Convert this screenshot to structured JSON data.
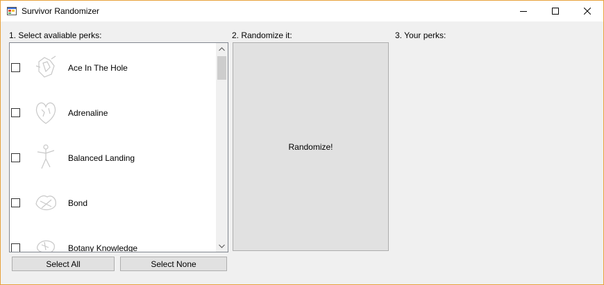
{
  "window": {
    "title": "Survivor Randomizer",
    "icon": "windows-forms-app-icon"
  },
  "controls": {
    "minimize_icon": "minimize-icon",
    "maximize_icon": "maximize-icon",
    "close_icon": "close-icon"
  },
  "section1": {
    "label": "1. Select avaliable perks:"
  },
  "section2": {
    "label": "2. Randomize it:"
  },
  "section3": {
    "label": "3. Your perks:"
  },
  "perks": [
    {
      "name": "Ace In The Hole",
      "checked": false,
      "icon": "ace-in-the-hole-icon"
    },
    {
      "name": "Adrenaline",
      "checked": false,
      "icon": "adrenaline-icon"
    },
    {
      "name": "Balanced Landing",
      "checked": false,
      "icon": "balanced-landing-icon"
    },
    {
      "name": "Bond",
      "checked": false,
      "icon": "bond-icon"
    },
    {
      "name": "Botany Knowledge",
      "checked": false,
      "icon": "botany-knowledge-icon"
    }
  ],
  "buttons": {
    "randomize": "Randomize!",
    "select_all": "Select All",
    "select_none": "Select None"
  },
  "colors": {
    "window_border": "#e8a23c",
    "background": "#f0f0f0",
    "button_face": "#e1e1e1"
  }
}
